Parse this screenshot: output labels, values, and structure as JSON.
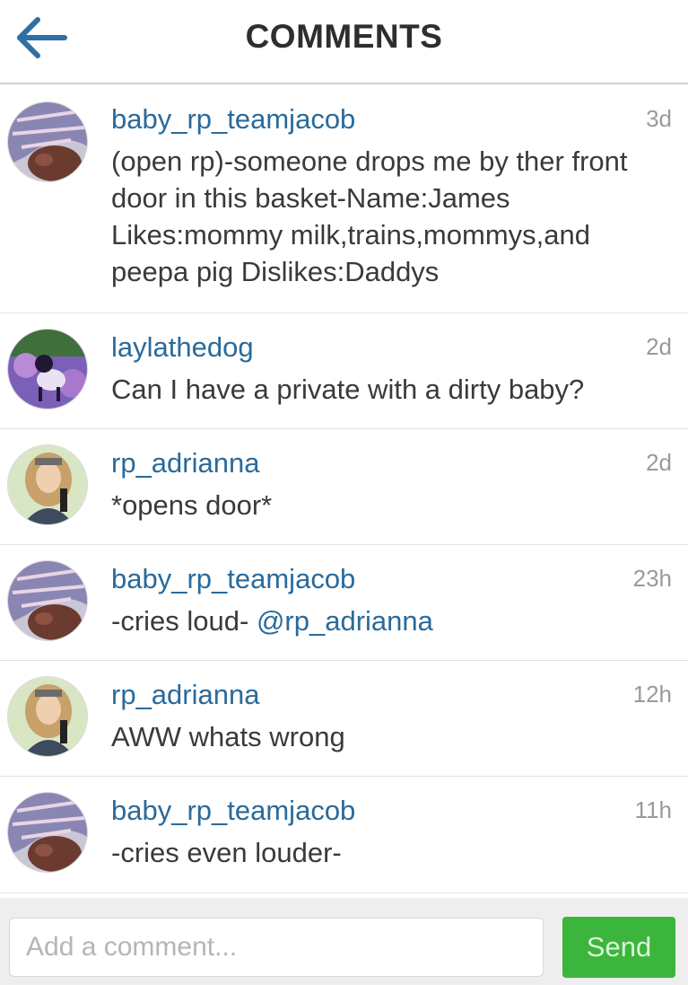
{
  "header": {
    "title": "COMMENTS",
    "back_icon": "back-arrow-icon"
  },
  "comments": [
    {
      "username": "baby_rp_teamjacob",
      "time": "3d",
      "text": "(open rp)-someone drops me by ther front door in this basket-Name:James Likes:mommy milk,trains,mommys,and peepa pig Dislikes:Daddys"
    },
    {
      "username": "laylathedog",
      "time": "2d",
      "text": "Can I have a private with a dirty baby?"
    },
    {
      "username": "rp_adrianna",
      "time": "2d",
      "text": "*opens door*"
    },
    {
      "username": "baby_rp_teamjacob",
      "time": "23h",
      "text": "-cries loud-",
      "mention": "@rp_adrianna"
    },
    {
      "username": "rp_adrianna",
      "time": "12h",
      "text": "AWW whats wrong"
    },
    {
      "username": "baby_rp_teamjacob",
      "time": "11h",
      "text": "-cries even louder-"
    }
  ],
  "composer": {
    "placeholder": "Add a comment...",
    "send_label": "Send"
  },
  "colors": {
    "link": "#2a6a9a",
    "send": "#3cb53c",
    "back_arrow": "#2f6fa3"
  }
}
